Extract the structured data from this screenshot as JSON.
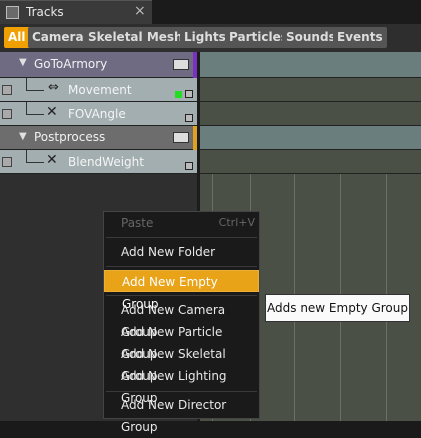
{
  "window": {
    "tab_title": "Tracks",
    "close_glyph": "×"
  },
  "filters": [
    {
      "label": "All",
      "active": true
    },
    {
      "label": "Cameras"
    },
    {
      "label": "Skeletal Meshes"
    },
    {
      "label": "Lights"
    },
    {
      "label": "Particles"
    },
    {
      "label": "Sounds"
    },
    {
      "label": "Events"
    }
  ],
  "tracks": {
    "group1": {
      "label": "GoToArmory",
      "expand_glyph": "▼"
    },
    "movement": {
      "label": "Movement"
    },
    "fovangle": {
      "label": "FOVAngle"
    },
    "group2": {
      "label": "Postprocess",
      "expand_glyph": "▼"
    },
    "blendweight": {
      "label": "BlendWeight"
    }
  },
  "context_menu": {
    "paste": {
      "label": "Paste",
      "shortcut": "Ctrl+V"
    },
    "add_folder": "Add New Folder",
    "add_empty_group": "Add New Empty Group",
    "add_camera_group": "Add New Camera Group",
    "add_particle_group": "Add New Particle Group",
    "add_skeletal_group": "Add New Skeletal Group",
    "add_lighting_group": "Add New Lighting Group",
    "add_director_group": "Add New Director Group"
  },
  "tooltip": "Adds new Empty Group",
  "colors": {
    "accent": "#f0a000",
    "menu_highlight": "#e8a318"
  }
}
